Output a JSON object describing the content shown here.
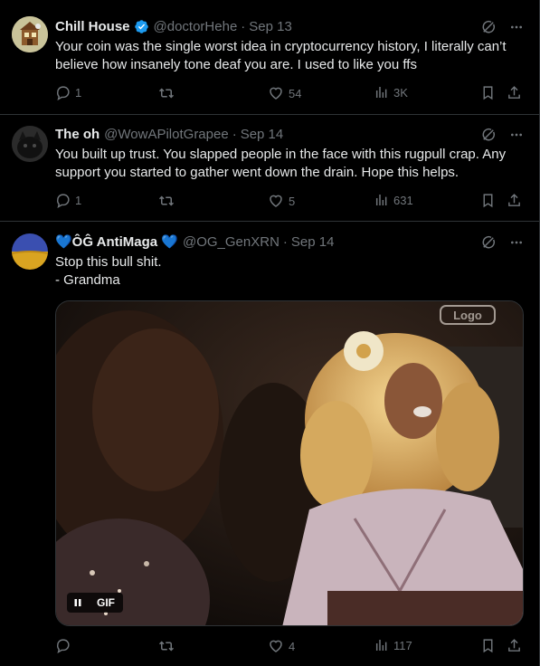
{
  "tweets": [
    {
      "name": "Chill House",
      "handle": "@doctorHehe",
      "date": "Sep 13",
      "text": "Your coin was the single worst idea in cryptocurrency history, I literally can’t believe how insanely tone deaf you are. I used to like you ffs",
      "replies": "1",
      "retweets": "",
      "likes": "54",
      "views": "3K"
    },
    {
      "name": "The oh",
      "handle": "@WowAPilotGrapee",
      "date": "Sep 14",
      "text": "You built up trust. You slapped people in the face with this rugpull crap. Any support you started to gather went down the drain. Hope this helps.",
      "replies": "1",
      "retweets": "",
      "likes": "5",
      "views": "631"
    },
    {
      "name": "💙ÔĜ AntiMaga 💙",
      "handle": "@OG_GenXRN",
      "date": "Sep 14",
      "text_line1": "Stop this bull shit.",
      "text_line2": "- Grandma",
      "gif_label": "GIF",
      "gif_watermark": "Logo",
      "replies": "",
      "retweets": "",
      "likes": "4",
      "views": "117"
    }
  ],
  "separator": "·",
  "colors": {
    "background": "#000000",
    "text": "#e7e9ea",
    "muted": "#71767b",
    "verified": "#1d9bf0",
    "border": "#2f3336"
  }
}
